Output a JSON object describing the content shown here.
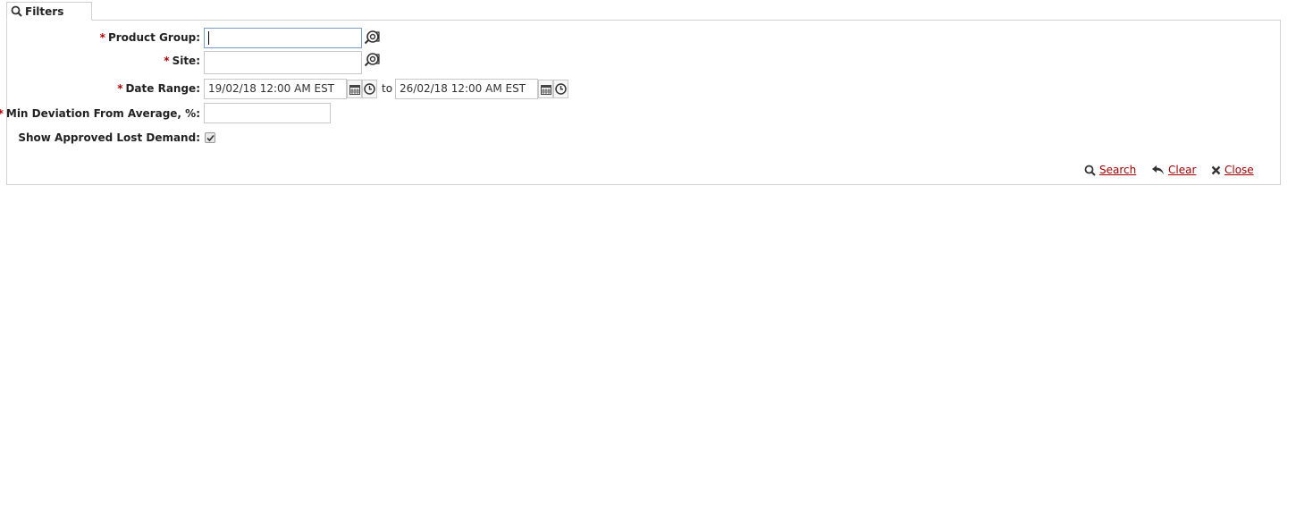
{
  "tab": {
    "label": "Filters",
    "icon": "search-icon"
  },
  "fields": {
    "product_group": {
      "required_mark": "*",
      "label": "Product Group:",
      "value": "",
      "lookup_icon": "binoculars-icon"
    },
    "site": {
      "required_mark": "*",
      "label": "Site:",
      "value": "",
      "lookup_icon": "binoculars-icon"
    },
    "date_range": {
      "required_mark": "*",
      "label": "Date Range:",
      "from_value": "19/02/18 12:00 AM EST",
      "to_label": "to",
      "to_value": "26/02/18 12:00 AM EST"
    },
    "min_deviation": {
      "required_mark": "*",
      "label": "Min Deviation From Average, %:",
      "value": ""
    },
    "show_approved": {
      "label": "Show Approved Lost Demand:",
      "checked": true
    }
  },
  "actions": {
    "search_label": "Search",
    "clear_label": "Clear",
    "close_label": "Close"
  },
  "colors": {
    "required": "#b00000",
    "link": "#a00000",
    "border": "#d0d0d0"
  }
}
